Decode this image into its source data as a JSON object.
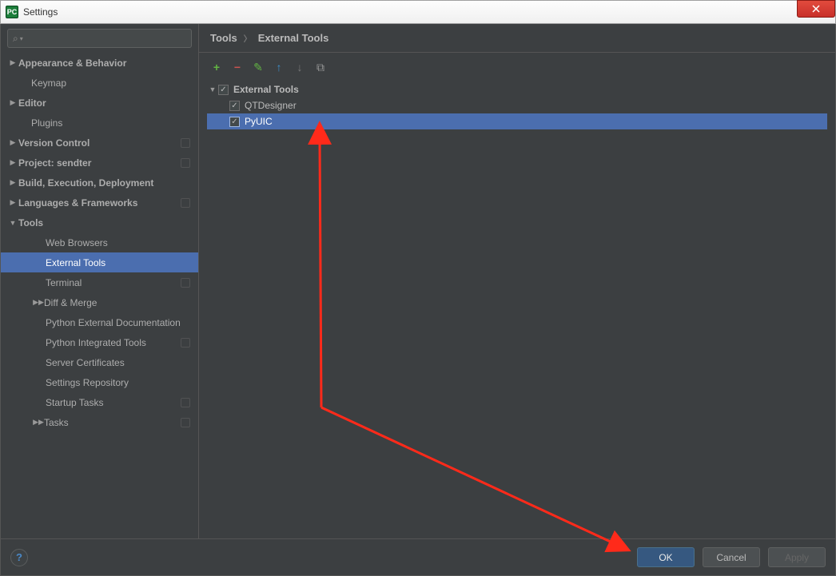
{
  "window": {
    "title": "Settings",
    "app_icon_text": "PC"
  },
  "breadcrumb": {
    "root": "Tools",
    "leaf": "External Tools"
  },
  "sidebar": {
    "items": [
      {
        "label": "Appearance & Behavior",
        "type": "collapsed",
        "bold": true
      },
      {
        "label": "Keymap",
        "type": "leaf",
        "indent": 1
      },
      {
        "label": "Editor",
        "type": "collapsed",
        "bold": true
      },
      {
        "label": "Plugins",
        "type": "leaf",
        "indent": 1
      },
      {
        "label": "Version Control",
        "type": "collapsed",
        "bold": true,
        "badge": true
      },
      {
        "label": "Project: sendter",
        "type": "collapsed",
        "bold": true,
        "badge": true
      },
      {
        "label": "Build, Execution, Deployment",
        "type": "collapsed",
        "bold": true
      },
      {
        "label": "Languages & Frameworks",
        "type": "collapsed",
        "bold": true,
        "badge": true
      },
      {
        "label": "Tools",
        "type": "expanded",
        "bold": true
      },
      {
        "label": "Web Browsers",
        "type": "leaf",
        "indent": 2
      },
      {
        "label": "External Tools",
        "type": "leaf",
        "indent": 2,
        "selected": true
      },
      {
        "label": "Terminal",
        "type": "leaf",
        "indent": 2,
        "badge": true
      },
      {
        "label": "Diff & Merge",
        "type": "collapsed",
        "indent": 2,
        "childArrow": true
      },
      {
        "label": "Python External Documentation",
        "type": "leaf",
        "indent": 2
      },
      {
        "label": "Python Integrated Tools",
        "type": "leaf",
        "indent": 2,
        "badge": true
      },
      {
        "label": "Server Certificates",
        "type": "leaf",
        "indent": 2
      },
      {
        "label": "Settings Repository",
        "type": "leaf",
        "indent": 2
      },
      {
        "label": "Startup Tasks",
        "type": "leaf",
        "indent": 2,
        "badge": true
      },
      {
        "label": "Tasks",
        "type": "collapsed",
        "indent": 2,
        "childArrow": true,
        "badge": true
      }
    ]
  },
  "toolbar": {
    "add": "+",
    "remove": "−",
    "edit": "✎",
    "up": "↑",
    "down": "↓",
    "copy": "⧉"
  },
  "externalTools": {
    "group": "External Tools",
    "items": [
      {
        "name": "QTDesigner",
        "checked": true,
        "selected": false
      },
      {
        "name": "PyUIC",
        "checked": true,
        "selected": true
      }
    ]
  },
  "buttons": {
    "ok": "OK",
    "cancel": "Cancel",
    "apply": "Apply",
    "help": "?"
  }
}
